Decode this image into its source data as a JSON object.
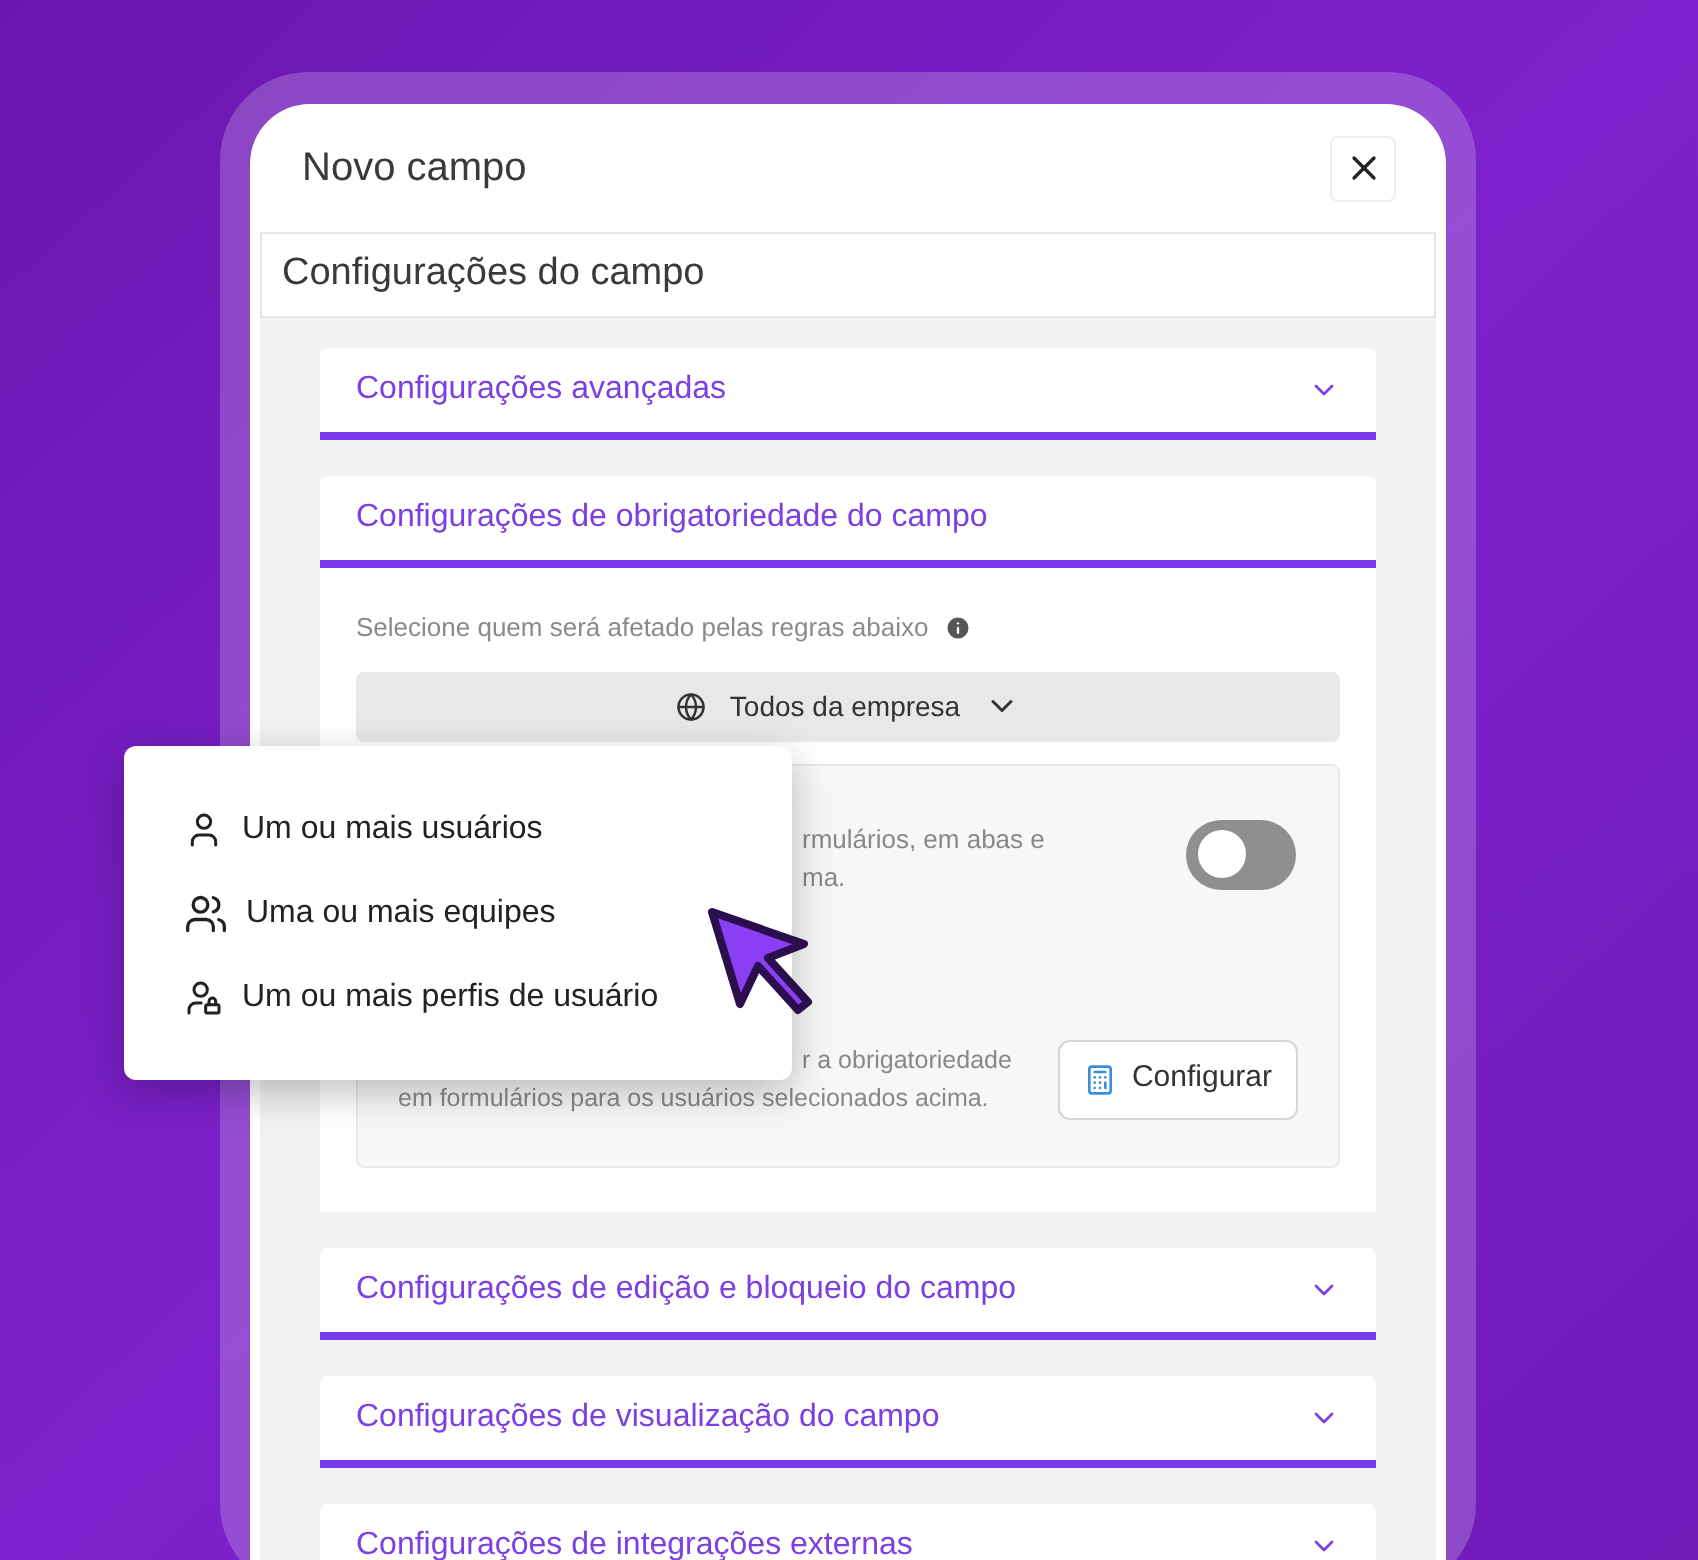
{
  "dialog": {
    "title": "Novo campo",
    "section_title": "Configurações do campo"
  },
  "accordions": [
    {
      "title": "Configurações avançadas",
      "expanded": false
    },
    {
      "title": "Configurações de obrigatoriedade do campo",
      "expanded": true,
      "body": {
        "hint": "Selecione quem será afetado pelas regras abaixo",
        "scope_button": "Todos da empresa",
        "rule_1": {
          "lines": [
            "rmulários, em abas e",
            "ma."
          ],
          "toggle_on": false
        },
        "rule_2": {
          "lines": [
            "r a obrigatoriedade",
            "em formulários para os usuários selecionados acima."
          ],
          "button": "Configurar"
        }
      }
    },
    {
      "title": "Configurações de edição e bloqueio do campo",
      "expanded": false
    },
    {
      "title": "Configurações de visualização do campo",
      "expanded": false
    },
    {
      "title": "Configurações de integrações externas",
      "expanded": false
    }
  ],
  "menu": {
    "items": [
      {
        "label": "Um ou mais usuários",
        "kind": "user"
      },
      {
        "label": "Uma ou mais equipes",
        "kind": "team"
      },
      {
        "label": "Um ou mais perfis de usuário",
        "kind": "profile"
      }
    ]
  }
}
